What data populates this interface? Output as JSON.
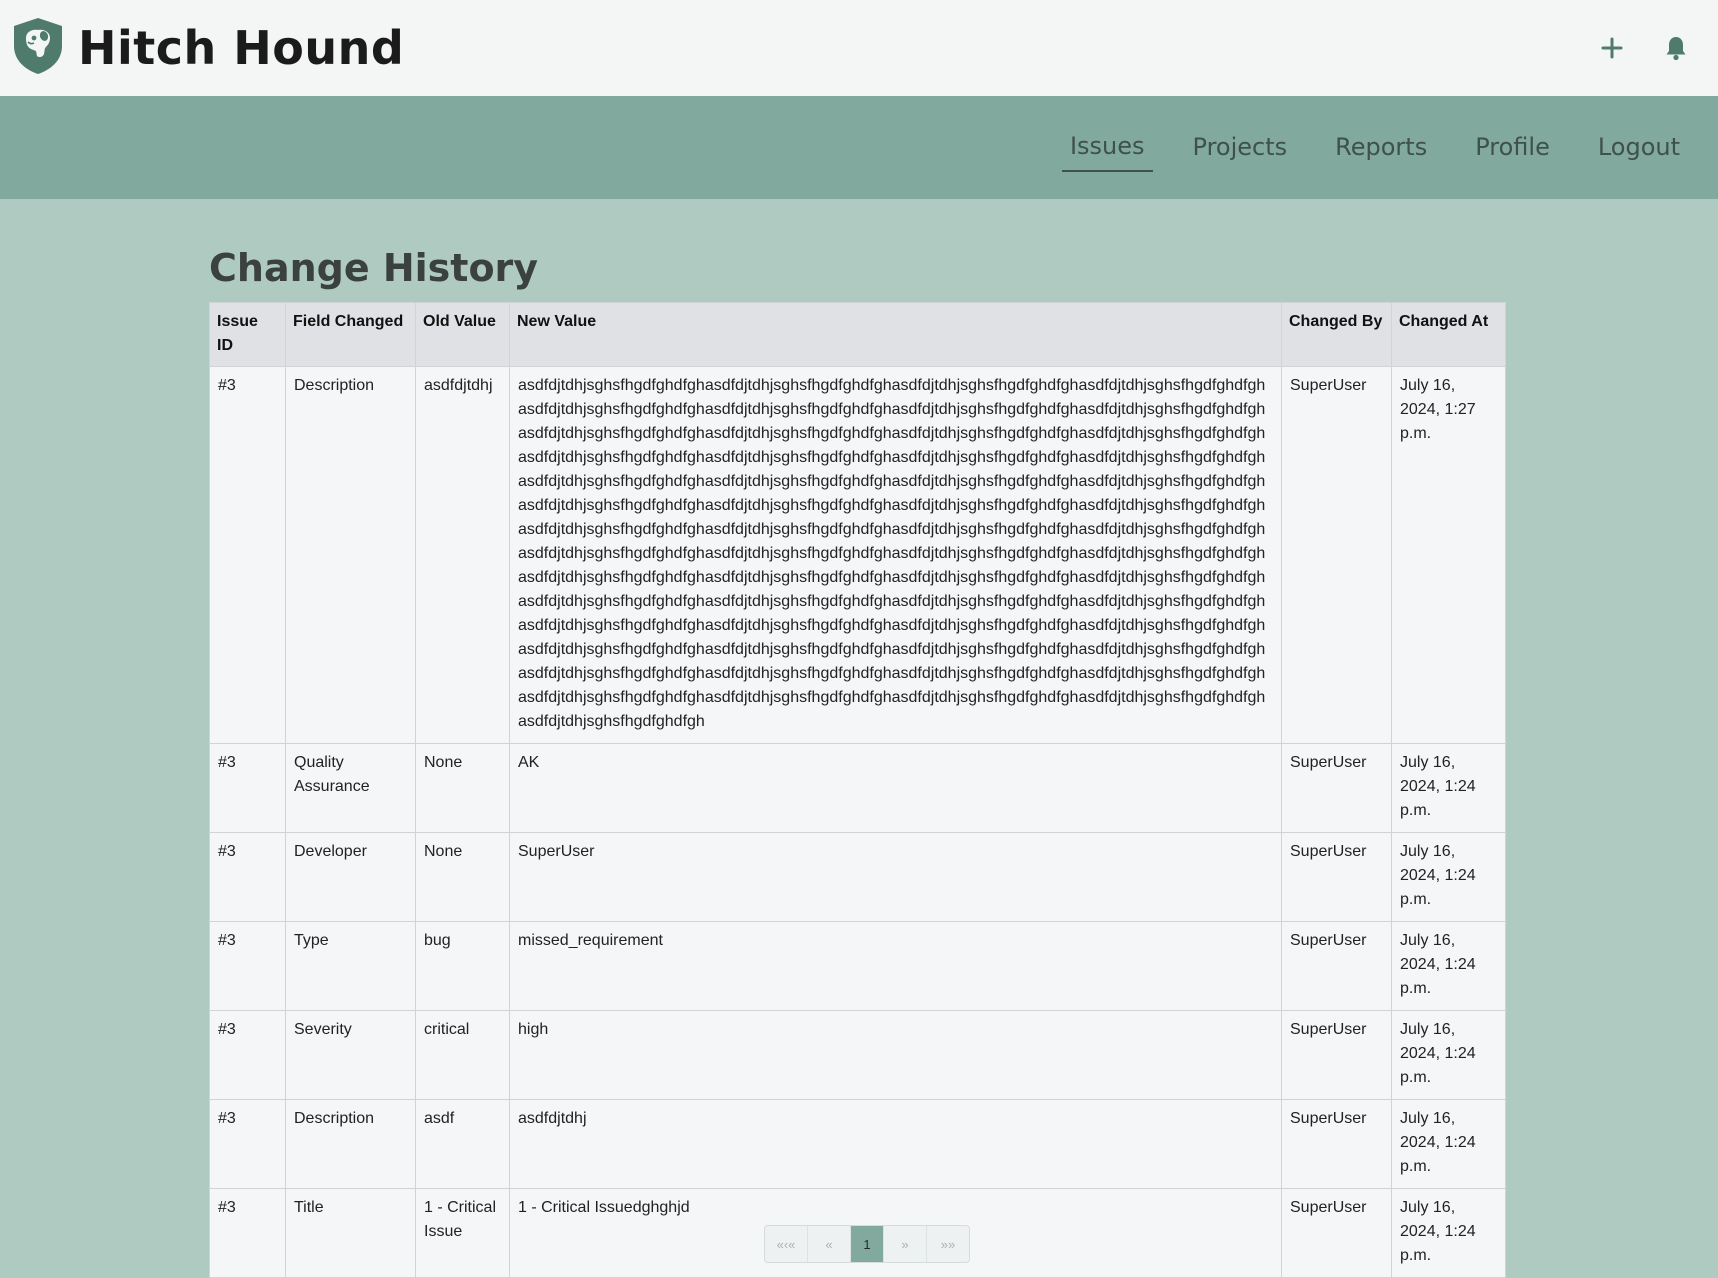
{
  "app": {
    "title": "Hitch Hound"
  },
  "nav": {
    "items": [
      "Issues",
      "Projects",
      "Reports",
      "Profile",
      "Logout"
    ],
    "active": "Issues"
  },
  "page": {
    "title": "Change History"
  },
  "table": {
    "headers": [
      "Issue ID",
      "Field Changed",
      "Old Value",
      "New Value",
      "Changed By",
      "Changed At"
    ],
    "rows": [
      [
        "#3",
        "Description",
        "asdfdjtdhj",
        "asdfdjtdhjsghsfhgdfghdfghasdfdjtdhjsghsfhgdfghdfghasdfdjtdhjsghsfhgdfghdfghasdfdjtdhjsghsfhgdfghdfghasdfdjtdhjsghsfhgdfghdfghasdfdjtdhjsghsfhgdfghdfghasdfdjtdhjsghsfhgdfghdfghasdfdjtdhjsghsfhgdfghdfghasdfdjtdhjsghsfhgdfghdfghasdfdjtdhjsghsfhgdfghdfghasdfdjtdhjsghsfhgdfghdfghasdfdjtdhjsghsfhgdfghdfghasdfdjtdhjsghsfhgdfghdfghasdfdjtdhjsghsfhgdfghdfghasdfdjtdhjsghsfhgdfghdfghasdfdjtdhjsghsfhgdfghdfghasdfdjtdhjsghsfhgdfghdfghasdfdjtdhjsghsfhgdfghdfghasdfdjtdhjsghsfhgdfghdfghasdfdjtdhjsghsfhgdfghdfghasdfdjtdhjsghsfhgdfghdfghasdfdjtdhjsghsfhgdfghdfghasdfdjtdhjsghsfhgdfghdfghasdfdjtdhjsghsfhgdfghdfghasdfdjtdhjsghsfhgdfghdfghasdfdjtdhjsghsfhgdfghdfghasdfdjtdhjsghsfhgdfghdfghasdfdjtdhjsghsfhgdfghdfghasdfdjtdhjsghsfhgdfghdfghasdfdjtdhjsghsfhgdfghdfghasdfdjtdhjsghsfhgdfghdfghasdfdjtdhjsghsfhgdfghdfghasdfdjtdhjsghsfhgdfghdfghasdfdjtdhjsghsfhgdfghdfghasdfdjtdhjsghsfhgdfghdfghasdfdjtdhjsghsfhgdfghdfghasdfdjtdhjsghsfhgdfghdfghasdfdjtdhjsghsfhgdfghdfghasdfdjtdhjsghsfhgdfghdfghasdfdjtdhjsghsfhgdfghdfghasdfdjtdhjsghsfhgdfghdfghasdfdjtdhjsghsfhgdfghdfghasdfdjtdhjsghsfhgdfghdfghasdfdjtdhjsghsfhgdfghdfghasdfdjtdhjsghsfhgdfghdfghasdfdjtdhjsghsfhgdfghdfghasdfdjtdhjsghsfhgdfghdfghasdfdjtdhjsghsfhgdfghdfghasdfdjtdhjsghsfhgdfghdfghasdfdjtdhjsghsfhgdfghdfghasdfdjtdhjsghsfhgdfghdfghasdfdjtdhjsghsfhgdfghdfghasdfdjtdhjsghsfhgdfghdfghasdfdjtdhjsghsfhgdfghdfghasdfdjtdhjsghsfhgdfghdfghasdfdjtdhjsghsfhgdfghdfghasdfdjtdhjsghsfhgdfghdfgh",
        "SuperUser",
        "July 16, 2024, 1:27 p.m."
      ],
      [
        "#3",
        "Quality Assurance",
        "None",
        "AK",
        "SuperUser",
        "July 16, 2024, 1:24 p.m."
      ],
      [
        "#3",
        "Developer",
        "None",
        "SuperUser",
        "SuperUser",
        "July 16, 2024, 1:24 p.m."
      ],
      [
        "#3",
        "Type",
        "bug",
        "missed_requirement",
        "SuperUser",
        "July 16, 2024, 1:24 p.m."
      ],
      [
        "#3",
        "Severity",
        "critical",
        "high",
        "SuperUser",
        "July 16, 2024, 1:24 p.m."
      ],
      [
        "#3",
        "Description",
        "asdf",
        "asdfdjtdhj",
        "SuperUser",
        "July 16, 2024, 1:24 p.m."
      ],
      [
        "#3",
        "Title",
        "1 - Critical Issue",
        "1 - Critical Issuedghghjd",
        "SuperUser",
        "July 16, 2024, 1:24 p.m."
      ]
    ]
  },
  "pagination": {
    "first": "«‹«",
    "prev": "«",
    "current": "1",
    "next": "»",
    "last": "»»"
  },
  "icons": {
    "logo": "shield-dog-logo-icon",
    "add": "plus-icon",
    "notifications": "bell-icon"
  },
  "colors": {
    "brand": "#4f7b6d",
    "navbar": "#81a99d",
    "background": "#afcac1"
  }
}
